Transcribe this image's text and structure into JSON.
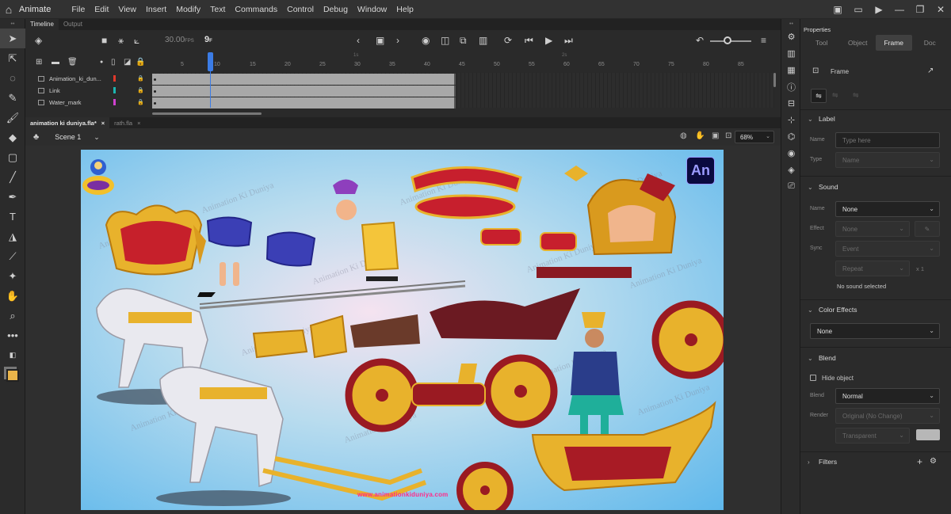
{
  "app": {
    "name": "Animate"
  },
  "menu": [
    "File",
    "Edit",
    "View",
    "Insert",
    "Modify",
    "Text",
    "Commands",
    "Control",
    "Debug",
    "Window",
    "Help"
  ],
  "timeline": {
    "tabs": [
      "Timeline",
      "Output"
    ],
    "fps": "30.00",
    "fps_unit": "FPS",
    "current_frame": "9",
    "frame_unit": "F",
    "ruler_ticks": [
      "5",
      "10",
      "15",
      "20",
      "25",
      "30",
      "35",
      "40",
      "45",
      "50",
      "55",
      "60",
      "65",
      "70",
      "75",
      "80",
      "85"
    ],
    "ruler_seconds": [
      "1s",
      "2s"
    ],
    "layers": [
      {
        "name": "Animation_ki_dun...",
        "color": "#e0392b"
      },
      {
        "name": "Link",
        "color": "#1db5b0"
      },
      {
        "name": "Water_mark",
        "color": "#d041d0"
      }
    ]
  },
  "documents": {
    "tabs": [
      {
        "name": "animation ki duniya.fla*",
        "close": "×"
      },
      {
        "name": "rath.fla",
        "close": "×"
      }
    ],
    "scene": "Scene 1",
    "zoom": "68%"
  },
  "stage": {
    "watermark": "Animation Ki Duniya",
    "logo_text": "An",
    "url": "www.animationkiduniya.com",
    "badge_text": "Animation Ki Duniya"
  },
  "properties": {
    "title": "Properties",
    "tabs": [
      "Tool",
      "Object",
      "Frame",
      "Doc"
    ],
    "active_tab": "Frame",
    "frame_label": "Frame",
    "label_section": {
      "title": "Label",
      "name_label": "Name",
      "name_placeholder": "Type here",
      "type_label": "Type",
      "type_value": "Name"
    },
    "sound_section": {
      "title": "Sound",
      "name_label": "Name",
      "name_value": "None",
      "effect_label": "Effect",
      "effect_value": "None",
      "sync_label": "Sync",
      "sync_value": "Event",
      "repeat_value": "Repeat",
      "repeat_count": "x 1",
      "note": "No sound selected"
    },
    "color_effects": {
      "title": "Color Effects",
      "value": "None"
    },
    "blend_section": {
      "title": "Blend",
      "hide_object": "Hide object",
      "blend_label": "Blend",
      "blend_value": "Normal",
      "render_label": "Render",
      "render_value": "Original (No Change)",
      "transparent_value": "Transparent"
    },
    "filters": {
      "title": "Filters"
    }
  }
}
